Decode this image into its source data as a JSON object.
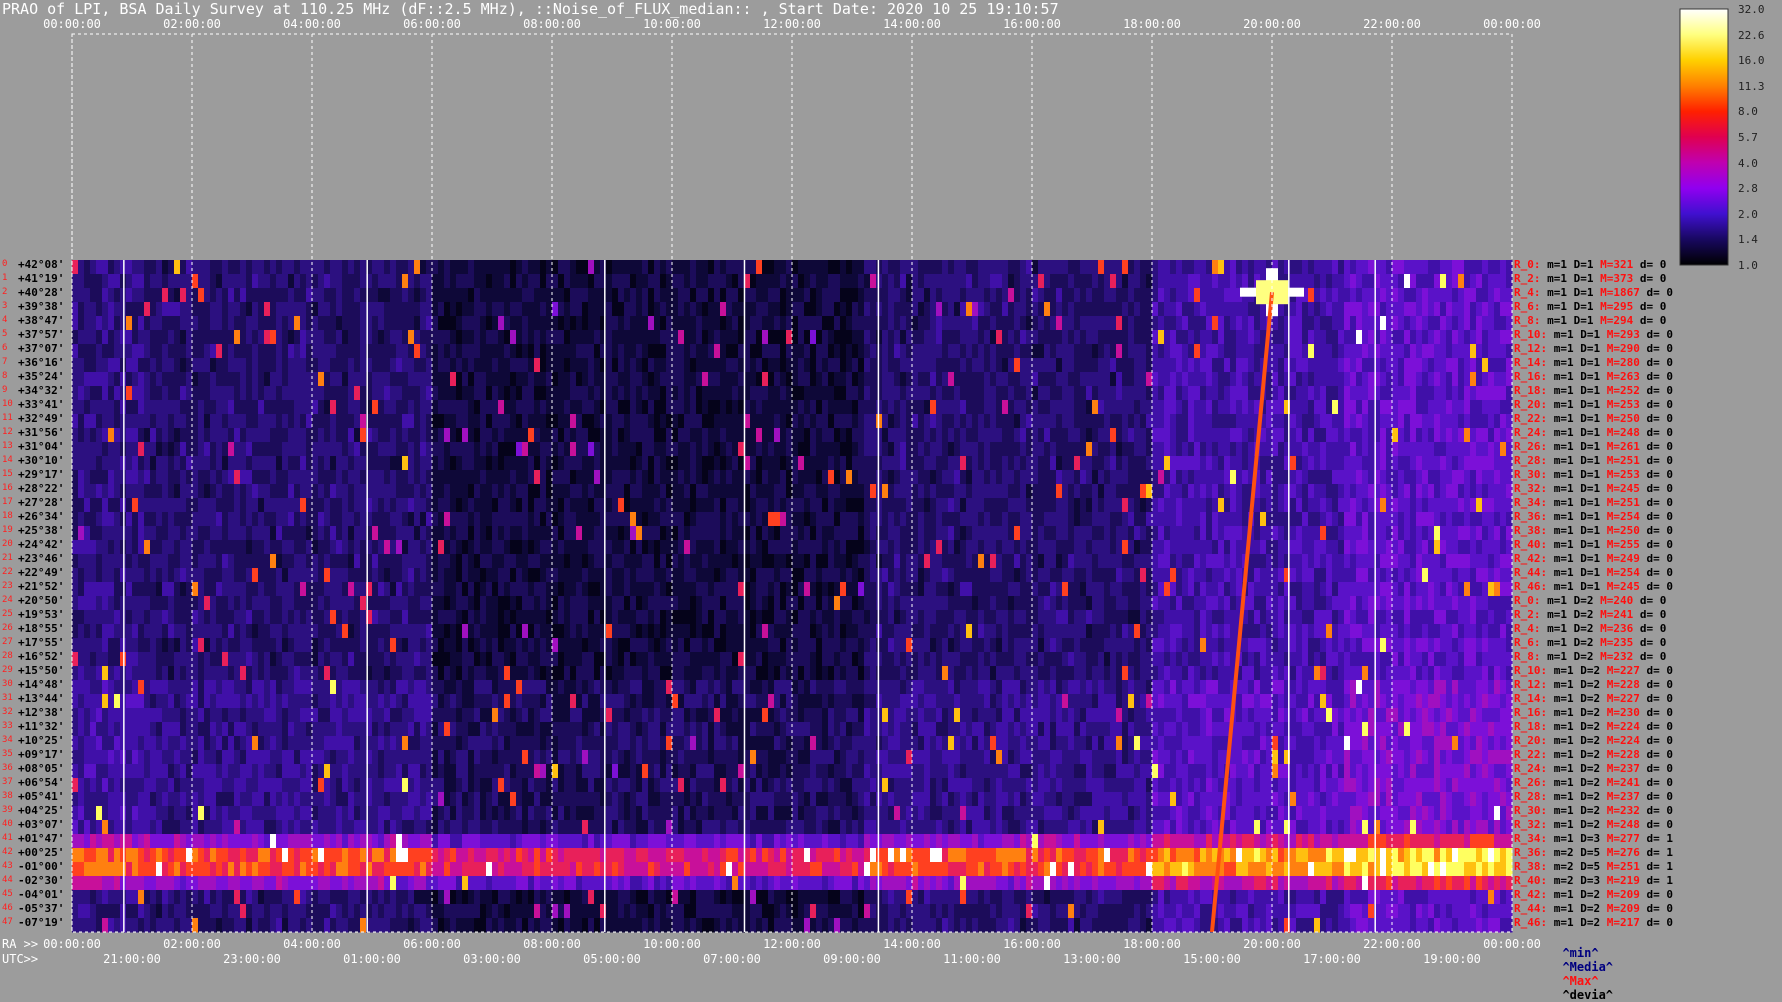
{
  "title": "PRAO of LPI, BSA Daily Survey at 110.25 MHz (dF::2.5 MHz), ::Noise_of_FLUX_median:: , Start Date: 2020 10 25 19:10:57",
  "chart_data": {
    "type": "heatmap",
    "title": "PRAO of LPI, BSA Daily Survey at 110.25 MHz (dF::2.5 MHz), ::Noise_of_FLUX_median:: , Start Date: 2020 10 25 19:10:57",
    "top_axis_labels": [
      "00:00:00",
      "02:00:00",
      "04:00:00",
      "06:00:00",
      "08:00:00",
      "10:00:00",
      "12:00:00",
      "14:00:00",
      "16:00:00",
      "18:00:00",
      "20:00:00",
      "22:00:00",
      "00:00:00"
    ],
    "ra_axis_prefix": "RA >>",
    "ra_axis_labels": [
      "00:00:00",
      "02:00:00",
      "04:00:00",
      "06:00:00",
      "08:00:00",
      "10:00:00",
      "12:00:00",
      "14:00:00",
      "16:00:00",
      "18:00:00",
      "20:00:00",
      "22:00:00",
      "00:00:00"
    ],
    "utc_axis_prefix": "UTC>>",
    "utc_axis_labels": [
      "21:00:00",
      "23:00:00",
      "01:00:00",
      "03:00:00",
      "05:00:00",
      "07:00:00",
      "09:00:00",
      "11:00:00",
      "13:00:00",
      "15:00:00",
      "17:00:00",
      "19:00:00"
    ],
    "declinations": [
      "+42°08'",
      "+41°19'",
      "+40°28'",
      "+39°38'",
      "+38°47'",
      "+37°57'",
      "+37°07'",
      "+36°16'",
      "+35°24'",
      "+34°32'",
      "+33°41'",
      "+32°49'",
      "+31°56'",
      "+31°04'",
      "+30°10'",
      "+29°17'",
      "+28°22'",
      "+27°28'",
      "+26°34'",
      "+25°38'",
      "+24°42'",
      "+23°46'",
      "+22°49'",
      "+21°52'",
      "+20°50'",
      "+19°53'",
      "+18°55'",
      "+17°55'",
      "+16°52'",
      "+15°50'",
      "+14°48'",
      "+13°44'",
      "+12°38'",
      "+11°32'",
      "+10°25'",
      "+09°17'",
      "+08°05'",
      "+06°54'",
      "+05°41'",
      "+04°25'",
      "+03°07'",
      "+01°47'",
      "+00°25'",
      "-01°00'",
      "-02°30'",
      "-04°01'",
      "-05°37'",
      "-07°19'"
    ],
    "row_indices": [
      "0",
      "1",
      "2",
      "3",
      "4",
      "5",
      "6",
      "7",
      "8",
      "9",
      "10",
      "11",
      "12",
      "13",
      "14",
      "15",
      "16",
      "17",
      "18",
      "19",
      "20",
      "21",
      "22",
      "23",
      "24",
      "25",
      "26",
      "27",
      "28",
      "29",
      "30",
      "31",
      "32",
      "33",
      "34",
      "35",
      "36",
      "37",
      "38",
      "39",
      "40",
      "41",
      "42",
      "43",
      "44",
      "45",
      "46",
      "47"
    ],
    "colorbar": {
      "ticks": [
        "32.0",
        "22.6",
        "16.0",
        "11.3",
        "8.0",
        "5.7",
        "4.0",
        "2.8",
        "2.0",
        "1.4",
        "1.0"
      ],
      "colors": [
        "#ffffff",
        "#ffff80",
        "#ffd000",
        "#ff8000",
        "#ff2000",
        "#e00050",
        "#c000b0",
        "#9000f0",
        "#4010d0",
        "#180860",
        "#000000"
      ]
    },
    "row_stats": [
      {
        "r": "R_0:",
        "m": "m=1",
        "D": "D=1",
        "M": "M=321",
        "d": "d= 0"
      },
      {
        "r": "R_2:",
        "m": "m=1",
        "D": "D=1",
        "M": "M=373",
        "d": "d= 0"
      },
      {
        "r": "R_4:",
        "m": "m=1",
        "D": "D=1",
        "M": "M=1867",
        "d": "d= 0"
      },
      {
        "r": "R_6:",
        "m": "m=1",
        "D": "D=1",
        "M": "M=295",
        "d": "d= 0"
      },
      {
        "r": "R_8:",
        "m": "m=1",
        "D": "D=1",
        "M": "M=294",
        "d": "d= 0"
      },
      {
        "r": "R_10:",
        "m": "m=1",
        "D": "D=1",
        "M": "M=293",
        "d": "d= 0"
      },
      {
        "r": "R_12:",
        "m": "m=1",
        "D": "D=1",
        "M": "M=290",
        "d": "d= 0"
      },
      {
        "r": "R_14:",
        "m": "m=1",
        "D": "D=1",
        "M": "M=280",
        "d": "d= 0"
      },
      {
        "r": "R_16:",
        "m": "m=1",
        "D": "D=1",
        "M": "M=263",
        "d": "d= 0"
      },
      {
        "r": "R_18:",
        "m": "m=1",
        "D": "D=1",
        "M": "M=252",
        "d": "d= 0"
      },
      {
        "r": "R_20:",
        "m": "m=1",
        "D": "D=1",
        "M": "M=253",
        "d": "d= 0"
      },
      {
        "r": "R_22:",
        "m": "m=1",
        "D": "D=1",
        "M": "M=250",
        "d": "d= 0"
      },
      {
        "r": "R_24:",
        "m": "m=1",
        "D": "D=1",
        "M": "M=248",
        "d": "d= 0"
      },
      {
        "r": "R_26:",
        "m": "m=1",
        "D": "D=1",
        "M": "M=261",
        "d": "d= 0"
      },
      {
        "r": "R_28:",
        "m": "m=1",
        "D": "D=1",
        "M": "M=251",
        "d": "d= 0"
      },
      {
        "r": "R_30:",
        "m": "m=1",
        "D": "D=1",
        "M": "M=253",
        "d": "d= 0"
      },
      {
        "r": "R_32:",
        "m": "m=1",
        "D": "D=1",
        "M": "M=245",
        "d": "d= 0"
      },
      {
        "r": "R_34:",
        "m": "m=1",
        "D": "D=1",
        "M": "M=251",
        "d": "d= 0"
      },
      {
        "r": "R_36:",
        "m": "m=1",
        "D": "D=1",
        "M": "M=254",
        "d": "d= 0"
      },
      {
        "r": "R_38:",
        "m": "m=1",
        "D": "D=1",
        "M": "M=250",
        "d": "d= 0"
      },
      {
        "r": "R_40:",
        "m": "m=1",
        "D": "D=1",
        "M": "M=255",
        "d": "d= 0"
      },
      {
        "r": "R_42:",
        "m": "m=1",
        "D": "D=1",
        "M": "M=249",
        "d": "d= 0"
      },
      {
        "r": "R_44:",
        "m": "m=1",
        "D": "D=1",
        "M": "M=254",
        "d": "d= 0"
      },
      {
        "r": "R_46:",
        "m": "m=1",
        "D": "D=1",
        "M": "M=245",
        "d": "d= 0"
      },
      {
        "r": "R_0:",
        "m": "m=1",
        "D": "D=2",
        "M": "M=240",
        "d": "d= 0"
      },
      {
        "r": "R_2:",
        "m": "m=1",
        "D": "D=2",
        "M": "M=241",
        "d": "d= 0"
      },
      {
        "r": "R_4:",
        "m": "m=1",
        "D": "D=2",
        "M": "M=236",
        "d": "d= 0"
      },
      {
        "r": "R_6:",
        "m": "m=1",
        "D": "D=2",
        "M": "M=235",
        "d": "d= 0"
      },
      {
        "r": "R_8:",
        "m": "m=1",
        "D": "D=2",
        "M": "M=232",
        "d": "d= 0"
      },
      {
        "r": "R_10:",
        "m": "m=1",
        "D": "D=2",
        "M": "M=227",
        "d": "d= 0"
      },
      {
        "r": "R_12:",
        "m": "m=1",
        "D": "D=2",
        "M": "M=228",
        "d": "d= 0"
      },
      {
        "r": "R_14:",
        "m": "m=1",
        "D": "D=2",
        "M": "M=227",
        "d": "d= 0"
      },
      {
        "r": "R_16:",
        "m": "m=1",
        "D": "D=2",
        "M": "M=230",
        "d": "d= 0"
      },
      {
        "r": "R_18:",
        "m": "m=1",
        "D": "D=2",
        "M": "M=224",
        "d": "d= 0"
      },
      {
        "r": "R_20:",
        "m": "m=1",
        "D": "D=2",
        "M": "M=224",
        "d": "d= 0"
      },
      {
        "r": "R_22:",
        "m": "m=1",
        "D": "D=2",
        "M": "M=228",
        "d": "d= 0"
      },
      {
        "r": "R_24:",
        "m": "m=1",
        "D": "D=2",
        "M": "M=237",
        "d": "d= 0"
      },
      {
        "r": "R_26:",
        "m": "m=1",
        "D": "D=2",
        "M": "M=241",
        "d": "d= 0"
      },
      {
        "r": "R_28:",
        "m": "m=1",
        "D": "D=2",
        "M": "M=237",
        "d": "d= 0"
      },
      {
        "r": "R_30:",
        "m": "m=1",
        "D": "D=2",
        "M": "M=232",
        "d": "d= 0"
      },
      {
        "r": "R_32:",
        "m": "m=1",
        "D": "D=2",
        "M": "M=248",
        "d": "d= 0"
      },
      {
        "r": "R_34:",
        "m": "m=1",
        "D": "D=3",
        "M": "M=277",
        "d": "d= 1"
      },
      {
        "r": "R_36:",
        "m": "m=2",
        "D": "D=5",
        "M": "M=276",
        "d": "d= 1"
      },
      {
        "r": "R_38:",
        "m": "m=2",
        "D": "D=5",
        "M": "M=251",
        "d": "d= 1"
      },
      {
        "r": "R_40:",
        "m": "m=2",
        "D": "D=3",
        "M": "M=219",
        "d": "d= 1"
      },
      {
        "r": "R_42:",
        "m": "m=1",
        "D": "D=2",
        "M": "M=209",
        "d": "d= 0"
      },
      {
        "r": "R_44:",
        "m": "m=1",
        "D": "D=2",
        "M": "M=209",
        "d": "d= 0"
      },
      {
        "r": "R_46:",
        "m": "m=1",
        "D": "D=2",
        "M": "M=217",
        "d": "d= 0"
      }
    ],
    "legend": {
      "min": "^min^",
      "median": "^Media^",
      "max": "^Max^",
      "dev": "^devia^"
    },
    "legend_colors": {
      "min": "#000080",
      "median": "#000080",
      "max": "#ff1010",
      "dev": "#000000"
    }
  }
}
